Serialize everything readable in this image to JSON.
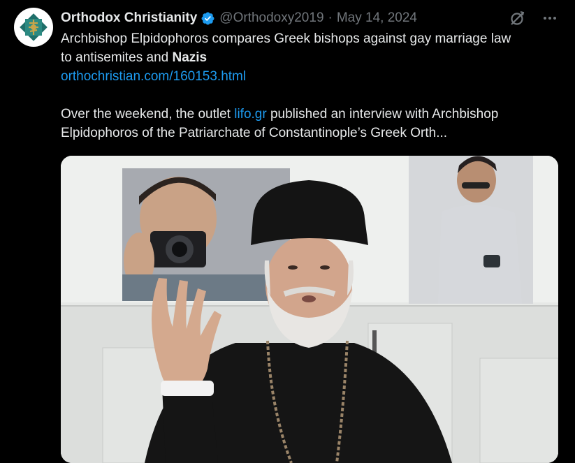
{
  "author": {
    "display_name": "Orthodox Christianity",
    "handle": "@Orthodoxy2019",
    "separator": "·",
    "date": "May 14, 2024",
    "verified": true,
    "avatar_icon": "orthodox-logo-icon"
  },
  "actions": {
    "grok_icon": "grok-icon",
    "more_icon": "more-icon"
  },
  "tweet": {
    "line1": "Archbishop Elpidophoros compares Greek bishops against gay marriage law",
    "line2_prefix": "to antisemites and ",
    "line2_bold": "Nazis",
    "link": "orthochristian.com/160153.html",
    "line4_prefix": "Over the weekend, the outlet ",
    "line4_link": "lifo.gr",
    "line4_suffix": " published an interview with Archbishop",
    "line5": "Elpidophoros of the Patriarchate of Constantinople’s Greek Orth..."
  },
  "colors": {
    "background": "#000000",
    "text": "#e7e9ea",
    "muted": "#71767b",
    "link": "#1d9bf0",
    "verified": "#1d9bf0"
  }
}
